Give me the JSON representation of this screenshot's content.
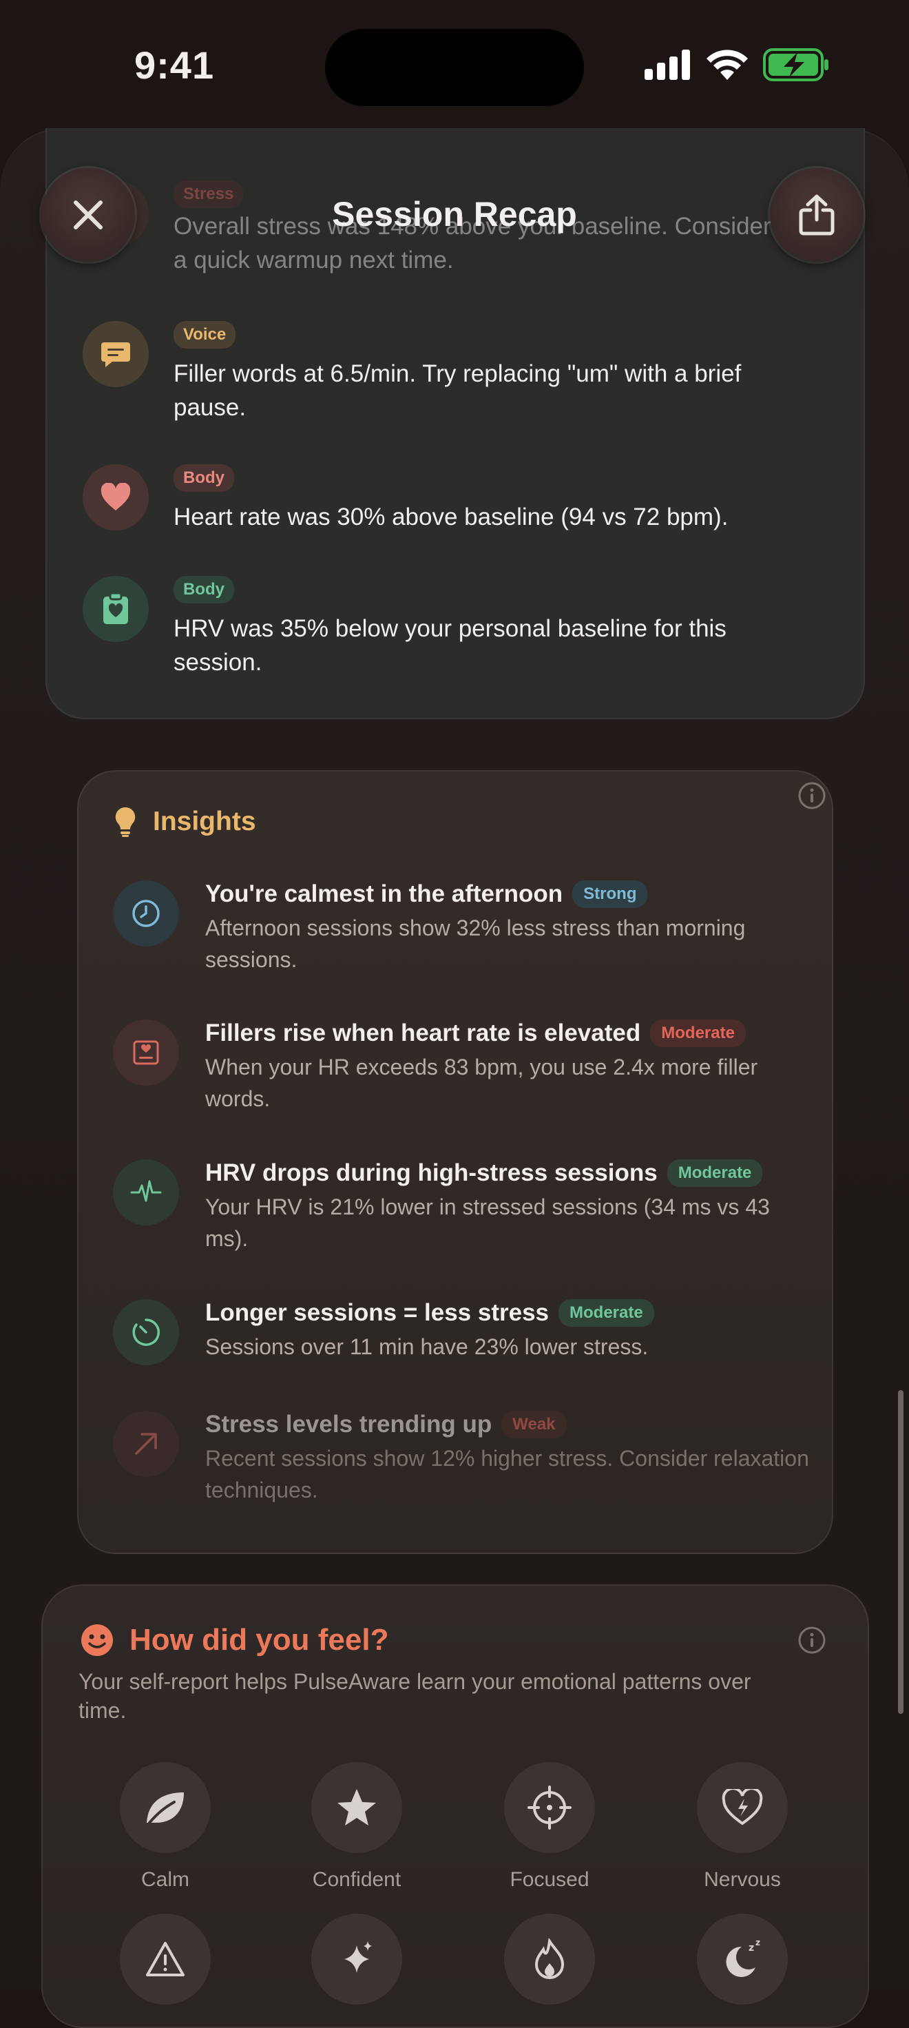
{
  "status_bar": {
    "time": "9:41"
  },
  "header": {
    "title": "Session Recap"
  },
  "feedback": {
    "items": [
      {
        "tag": "Stress",
        "text": "Overall stress was 148% above your baseline. Consider a quick warmup next time."
      },
      {
        "tag": "Voice",
        "text": "Filler words at 6.5/min. Try replacing \"um\" with a brief pause."
      },
      {
        "tag": "Body",
        "text": "Heart rate was 30% above baseline (94 vs 72 bpm)."
      },
      {
        "tag": "Body",
        "text": "HRV was 35% below your personal baseline for this session."
      }
    ]
  },
  "insights": {
    "title": "Insights",
    "items": [
      {
        "title": "You're calmest in the afternoon",
        "badge": "Strong",
        "desc": "Afternoon sessions show 32% less stress than morning sessions.",
        "icon": "clock-icon"
      },
      {
        "title": "Fillers rise when heart rate is elevated",
        "badge": "Moderate",
        "desc": "When your HR exceeds 83 bpm, you use 2.4x more filler words.",
        "icon": "heart-monitor-icon"
      },
      {
        "title": "HRV drops during high-stress sessions",
        "badge": "Moderate",
        "desc": "Your HRV is 21% lower in stressed sessions (34 ms vs 43 ms).",
        "icon": "waveform-icon"
      },
      {
        "title": "Longer sessions = less stress",
        "badge": "Moderate",
        "desc": "Sessions over 11 min have 23% lower stress.",
        "icon": "timer-icon"
      },
      {
        "title": "Stress levels trending up",
        "badge": "Weak",
        "desc": "Recent sessions show 12% higher stress. Consider relaxation techniques.",
        "icon": "trend-up-icon"
      }
    ]
  },
  "feel": {
    "title": "How did you feel?",
    "subtitle": "Your self-report helps PulseAware learn your emotional patterns over time.",
    "moods": [
      "Calm",
      "Confident",
      "Focused",
      "Nervous"
    ]
  },
  "colors": {
    "stress": "#e2665a",
    "voice": "#e9b86c",
    "body_red": "#e98a82",
    "body_green": "#6fc79a",
    "strong": "#7fb9d6",
    "moderate_red": "#e2665a",
    "moderate_green": "#6fc79a",
    "insights_accent": "#e9b86c",
    "feel_accent": "#ec7a5a"
  }
}
